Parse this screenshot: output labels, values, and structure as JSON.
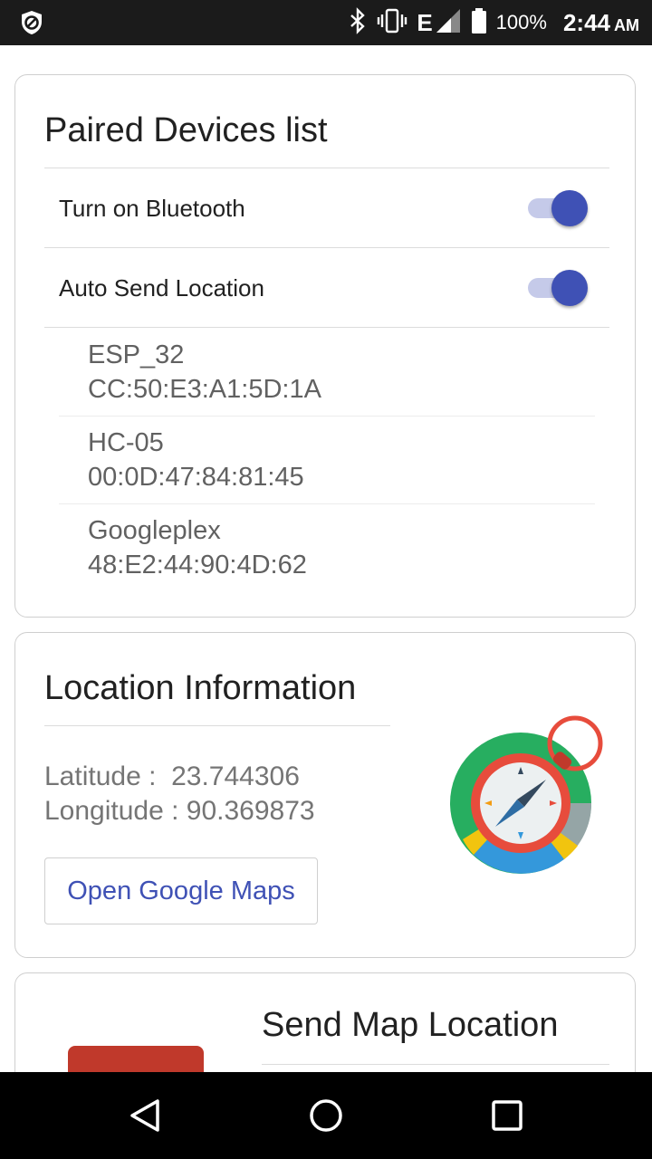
{
  "status_bar": {
    "left_icon": "shield-block-icon",
    "icons": [
      "bluetooth-icon",
      "vibrate-icon",
      "network-e-icon",
      "signal-icon",
      "battery-icon"
    ],
    "network_type": "E",
    "battery": "100%",
    "time": "2:44",
    "ampm": "AM"
  },
  "paired_card": {
    "title": "Paired Devices list",
    "bluetooth_toggle": {
      "label": "Turn on Bluetooth",
      "on": true
    },
    "auto_send_toggle": {
      "label": "Auto Send Location",
      "on": true
    },
    "devices": [
      {
        "name": "ESP_32",
        "mac": "CC:50:E3:A1:5D:1A"
      },
      {
        "name": "HC-05",
        "mac": "00:0D:47:84:81:45"
      },
      {
        "name": "Googleplex",
        "mac": "48:E2:44:90:4D:62"
      }
    ]
  },
  "location_card": {
    "title": "Location Information",
    "latitude": "Latitude :  23.744306",
    "longitude": "Longitude : 90.369873",
    "open_maps_label": "Open Google Maps",
    "illustration": "compass-icon"
  },
  "send_card": {
    "title": "Send Map Location",
    "illustration": "map-illustration"
  },
  "nav_bar": {
    "back": "back-icon",
    "home": "home-icon",
    "recents": "recents-icon"
  },
  "colors": {
    "accent": "#3f51b5",
    "accent_track": "#c5cae9",
    "status_bar": "#1b1b1b",
    "nav_bar": "#000000"
  }
}
